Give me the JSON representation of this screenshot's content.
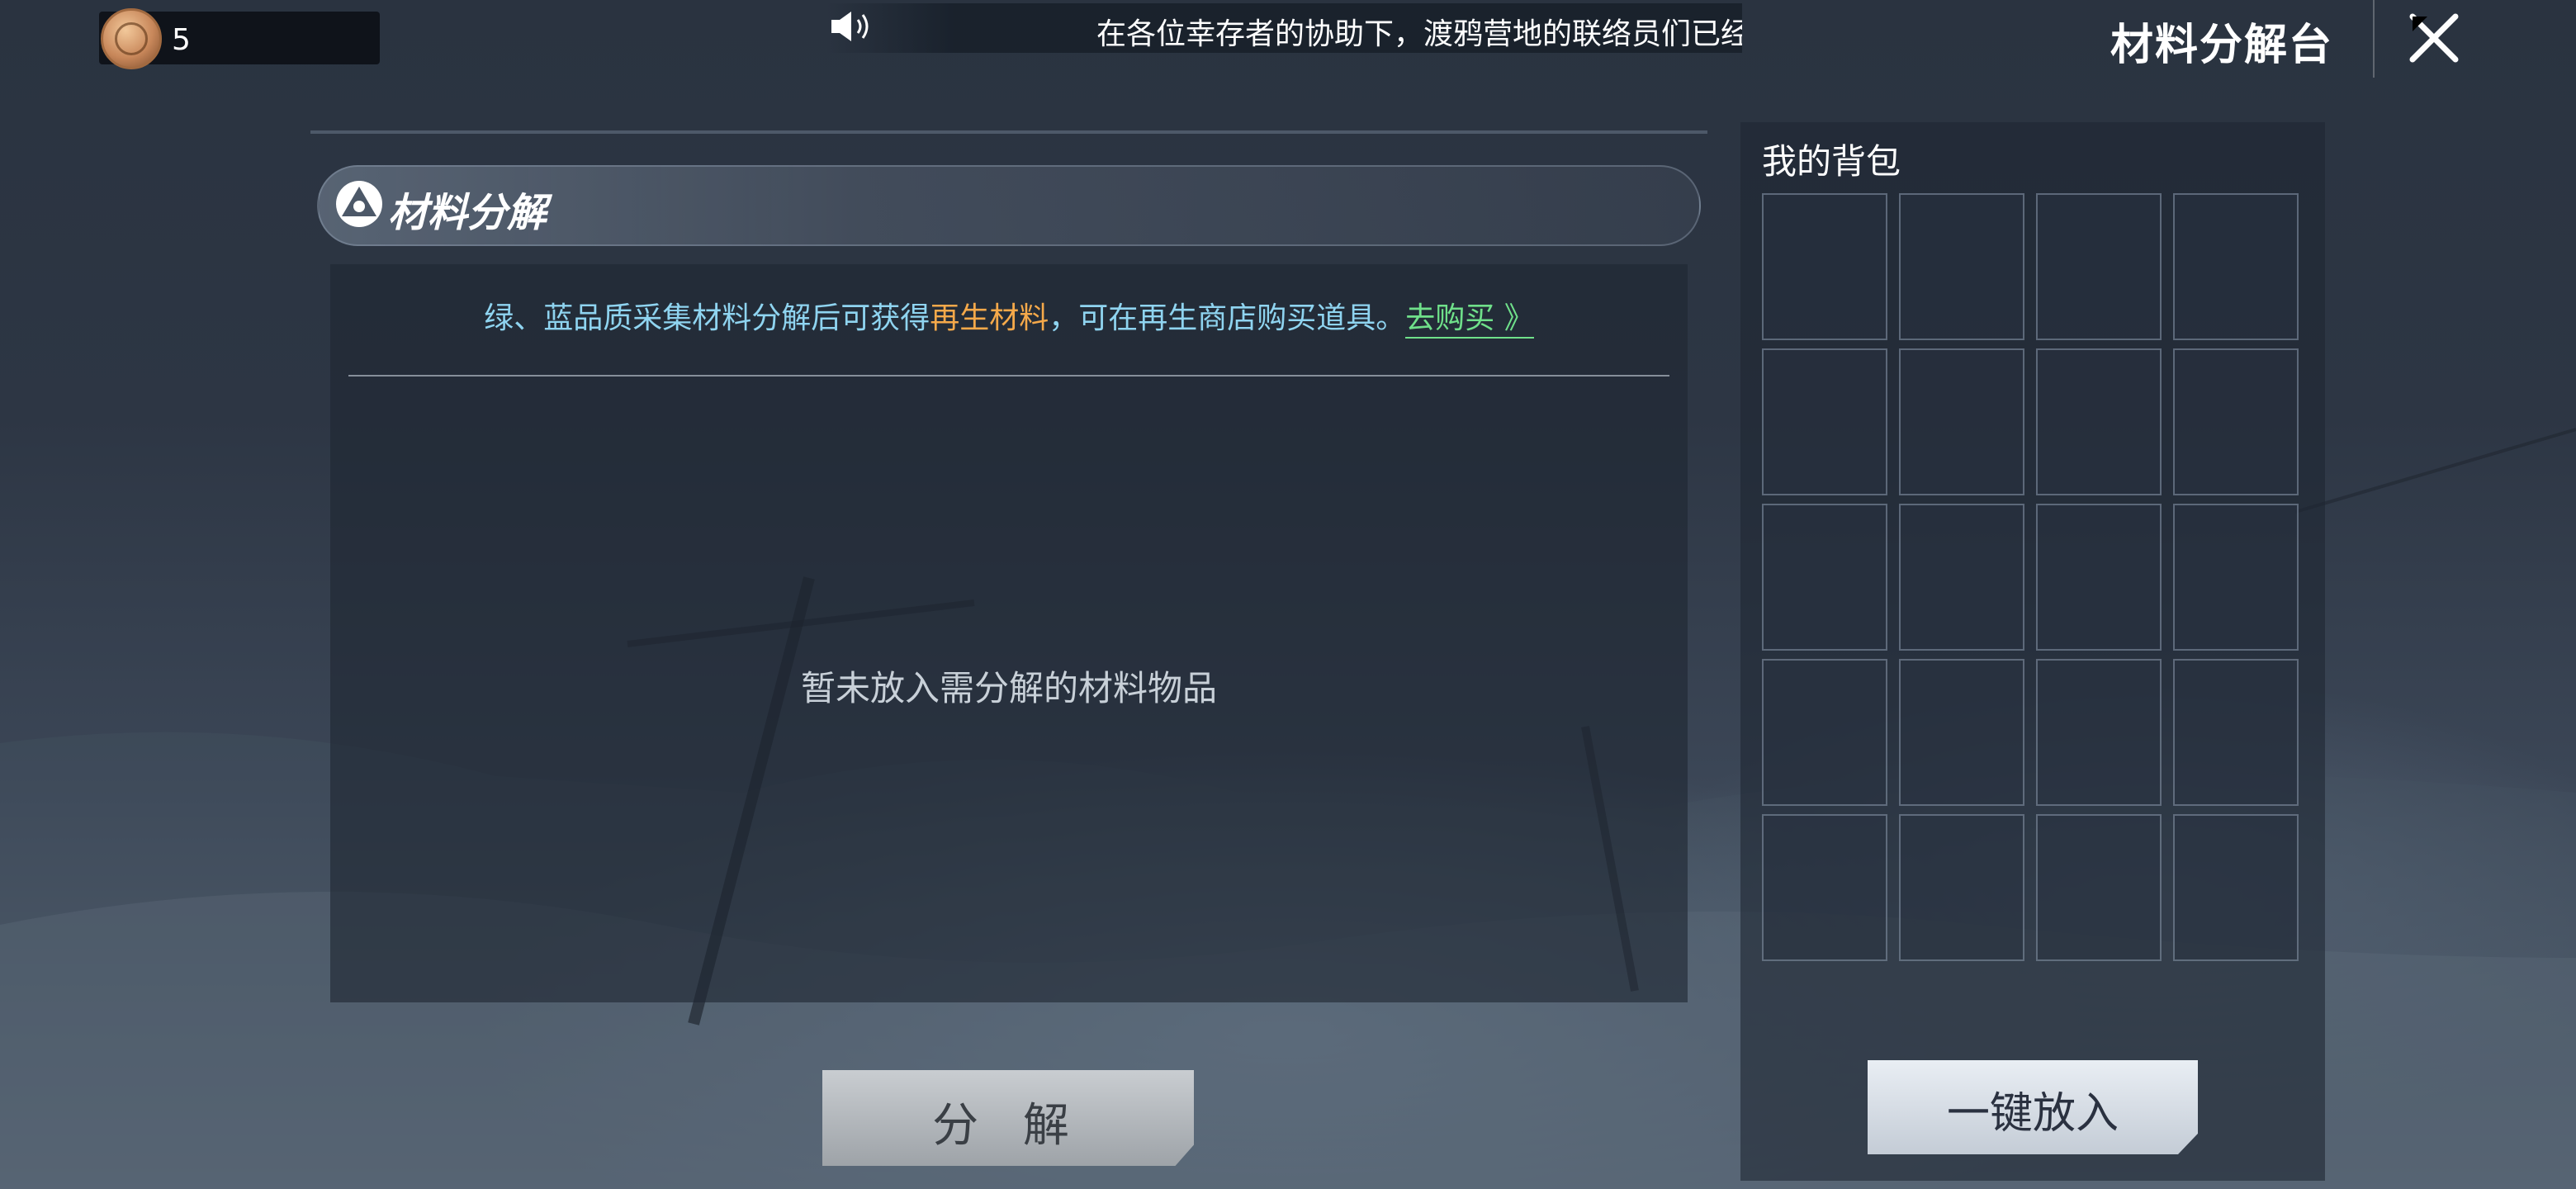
{
  "header": {
    "currency": {
      "icon": "coin-icon",
      "value": "5"
    },
    "announcement": {
      "icon": "speaker-icon",
      "text": "在各位幸存者的协助下，渡鸦营地的联络员们已经"
    },
    "title": "材料分解台",
    "close_icon": "close-icon"
  },
  "decompose_panel": {
    "section_title": "材料分解",
    "section_icon": "decompose-icon",
    "info": {
      "part1": "绿、蓝品质采集材料分解后可获得",
      "highlight": "再生材料",
      "part2": "，可在再生商店购买道具。",
      "link": "去购买 》"
    },
    "empty_message": "暂未放入需分解的材料物品",
    "decompose_button": "分 解"
  },
  "backpack": {
    "title": "我的背包",
    "auto_put_button": "一键放入"
  },
  "colors": {
    "info_text": "#8fd4f0",
    "highlight": "#f5a94a",
    "link": "#6fe08a"
  }
}
